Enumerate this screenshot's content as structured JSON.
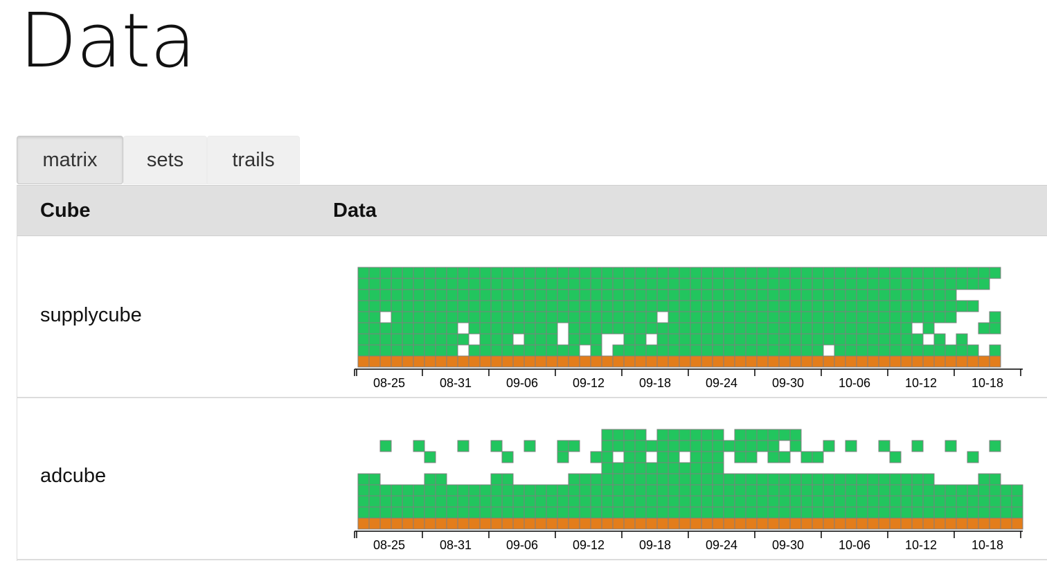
{
  "page": {
    "title": "Data"
  },
  "tabs": [
    {
      "label": "matrix",
      "active": true
    },
    {
      "label": "sets",
      "active": false
    },
    {
      "label": "trails",
      "active": false
    }
  ],
  "table": {
    "headers": {
      "cube": "Cube",
      "data": "Data"
    },
    "rows": [
      {
        "name": "supplycube"
      },
      {
        "name": "adcube"
      }
    ]
  },
  "colors": {
    "present": "#22c55e",
    "base": "#e37d1b",
    "cell_border": "#7f7f7f",
    "axis": "#000000"
  },
  "chart_data": [
    {
      "type": "heatmap",
      "name": "supplycube",
      "x_tick_labels": [
        "08-25",
        "08-31",
        "09-06",
        "09-12",
        "09-18",
        "09-24",
        "09-30",
        "10-06",
        "10-12",
        "10-18"
      ],
      "x_unit": "day",
      "columns": 58,
      "rows": 8,
      "grid": [
        "1111111111111111111111111111111111111111111111111111111111",
        "1111111111111111111111111111111111111111111111111111111110",
        "11111111111111111111111111111111111111111111111111111100",
        "11111111111111111111111111111111111111111111111111111111000",
        "1101111111111111111111111110111111111111111111111111110001",
        "1111111110111111110111111111111111111111111111111101000011",
        "1111111111011101110111001101111111111111111111111110101",
        "1111111110111111111101011111111111111111110111111111111101"
      ]
    },
    {
      "type": "heatmap",
      "name": "adcube",
      "x_tick_labels": [
        "08-25",
        "08-31",
        "09-06",
        "09-12",
        "09-18",
        "09-24",
        "09-30",
        "10-06",
        "10-12",
        "10-18"
      ],
      "x_unit": "day",
      "columns": 60,
      "rows": 8,
      "grid": [
        "000000000000000000000011110111111011111100000000000000000000",
        "001001000100100100110011111111111111110100101001001001000100",
        "000000100000010000100110110110111011011011000000100000010000",
        "000000000000000000000011111111111000000000000000000000000000",
        "110000110000110000011111111111111111111111111111111100001100",
        "111111111111111111111111111111111111111111111111111111111111",
        "111111111111111111111111111111111111111111111111111111111111",
        "111111111111111111111111111111111111111111111111111111111111"
      ]
    }
  ]
}
